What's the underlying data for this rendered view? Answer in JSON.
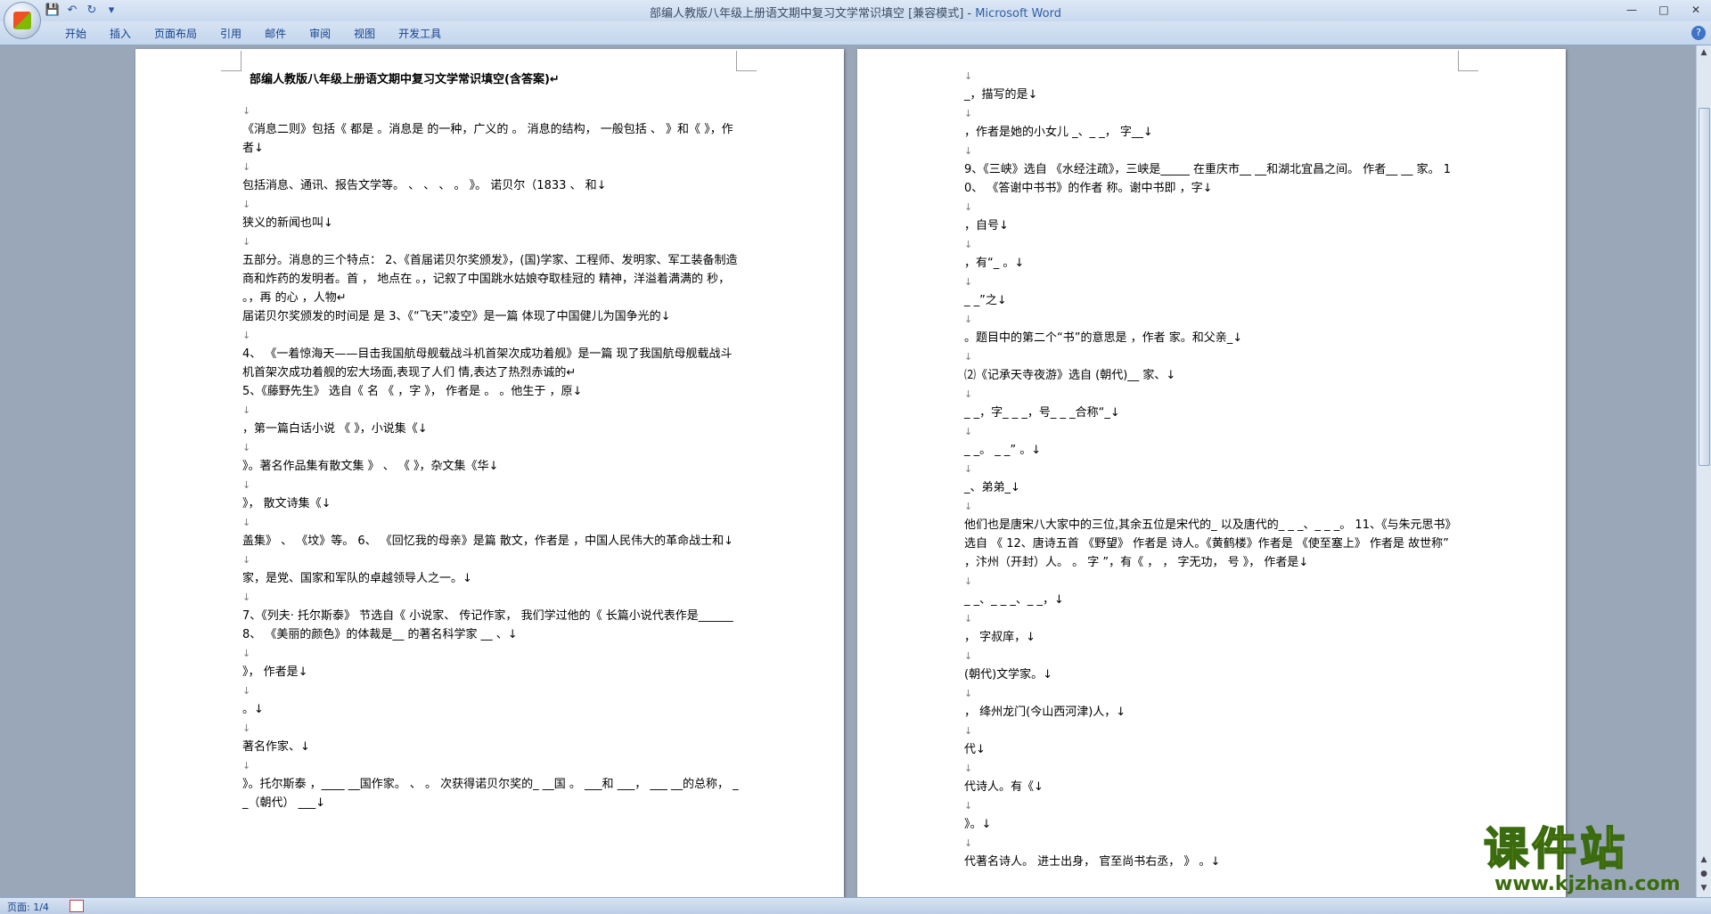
{
  "window": {
    "title": "部编人教版八年级上册语文期中复习文学常识填空 [兼容模式]",
    "title_sep": " - ",
    "app_name": "Microsoft Word",
    "minimize": "—",
    "maximize": "□",
    "close": "✕"
  },
  "qat": {
    "save": "💾",
    "undo": "↶",
    "redo": "↻",
    "more": "▾"
  },
  "ribbon": {
    "tabs": [
      "开始",
      "插入",
      "页面布局",
      "引用",
      "邮件",
      "审阅",
      "视图",
      "开发工具"
    ],
    "help": "?"
  },
  "left_page": {
    "title": "部编人教版八年级上册语文期中复习文学常识填空(含答案)↵",
    "paragraphs": [
      "↓",
      "《消息二则》包括《 都是 。消息是 的一种，广义的 。 消息的结构， 一般包括 、 》和《 》，作者↓",
      "↓",
      "包括消息、通讯、报告文学等。 、 、 、 。 》。 诺贝尔（1833 、 和↓",
      "↓",
      "狭义的新闻也叫↓",
      "↓",
      "五部分。消息的三个特点： 2、《首届诺贝尔奖颁发》，(国)学家、工程师、发明家、军工装备制造商和炸药的发明者。首 ， 地点在 。，记叙了中国跳水姑娘夺取桂冠的 精神，洋溢着满满的 秒， 。，再 的心 ，人物↵",
      "届诺贝尔奖颁发的时间是 是 3、《“飞天”凌空》是一篇 体现了中国健儿为国争光的↓",
      "↓",
      "4、 《一着惊海天——目击我国航母舰载战斗机首架次成功着舰》是一篇 现了我国航母舰载战斗机首架次成功着舰的宏大场面,表现了人们 情,表达了热烈赤诚的↵",
      " 5、《藤野先生》 选自《 名 《 ，字 》， 作者是 。 。他生于 ，原↓",
      "↓",
      "，第一篇白话小说 《 》，小说集《↓",
      "↓",
      "》。著名作品集有散文集 》 、 《 》，杂文集《华↓",
      "↓",
      "》， 散文诗集《↓",
      "↓",
      "盖集》 、 《坟》等。 6、 《回忆我的母亲》是篇 散文，作者是 ，中国人民伟大的革命战士和↓",
      "↓",
      "家，是党、国家和军队的卓越领导人之一。↓",
      "↓",
      "7、《列夫· 托尔斯泰》 节选自《 小说家、 传记作家， 我们学过他的《 长篇小说代表作是______8、 《美丽的颜色》的体裁是__ 的著名科学家 __ 、↓",
      "↓",
      "》， 作者是↓",
      "↓",
      "。↓",
      "↓",
      "著名作家、↓",
      "↓",
      "》。托尔斯泰 ，____ __国作家。 、 。 次获得诺贝尔奖的_ __国 。 ___和 ___， ___ __的总称， __（朝代） ___↓"
    ]
  },
  "right_page": {
    "paragraphs": [
      "↓",
      "_，描写的是↓",
      "↓",
      "，作者是她的小女儿 _、_ _， 字__↓",
      "↓",
      "9、《三峡》选自 《水经注疏》，三峡是_____ 在重庆市__ __和湖北宜昌之间。 作者__ __ 家。 10、 《答谢中书书》的作者 称。谢中书即 ，字↓",
      "↓",
      "，自号↓",
      "↓",
      "，有“_ 。↓",
      "↓",
      "_ _”之↓",
      "↓",
      "。题目中的第二个“书”的意思是 ，作者 家。和父亲_↓",
      "↓",
      "⑵《记承天寺夜游》选自 (朝代)__ 家、↓",
      "↓",
      "_ _，字_ _ _，号_ _ _合称“_↓",
      "↓",
      "_ _。 _ _” 。↓",
      "↓",
      "_、弟弟_↓",
      "↓",
      "他们也是唐宋八大家中的三位,其余五位是宋代的_ 以及唐代的_ _ _、_ _ _。 11、《与朱元思书》 选自 《 12、唐诗五首 《野望》 作者是 诗人。《黄鹤楼》作者是 《使至塞上》 作者是 故世称” ，汴州（开封）人。 。 字 ”，有《 ， ， 字无功， 号 》， 作者是↓",
      "↓",
      "_ _、_ _ _、_ _，↓",
      "↓",
      "， 字叔庠，↓",
      "↓",
      "(朝代)文学家。↓",
      "↓",
      "， 绛州龙门(今山西河津)人，↓",
      "↓",
      "代↓",
      "↓",
      "代诗人。有《↓",
      "↓",
      "》。↓",
      "↓",
      "代著名诗人。 进士出身， 官至尚书右丞， 》 。↓"
    ]
  },
  "status": {
    "page_info": "页面: 1/4"
  },
  "watermark": {
    "main": "课件站",
    "url": "www.kjzhan.com"
  }
}
